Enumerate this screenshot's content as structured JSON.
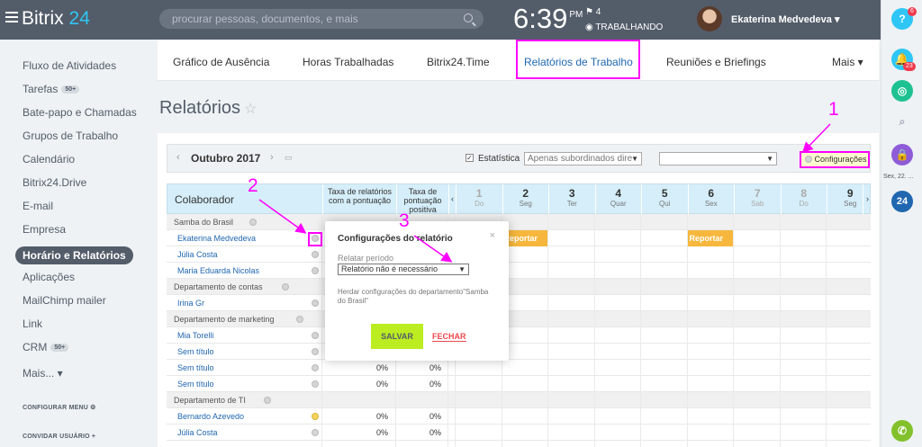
{
  "header": {
    "logo_text": "Bitrix",
    "logo_num": "24",
    "search_placeholder": "procurar pessoas, documentos, e mais",
    "time": "6:39",
    "ampm": "PM",
    "flag_count": "⚑ 4",
    "status": "◉ TRABALHANDO",
    "user_name": "Ekaterina Medvedeva ▾"
  },
  "sidebar": {
    "items": [
      {
        "label": "Fluxo de Atividades"
      },
      {
        "label": "Tarefas",
        "badge": "50+"
      },
      {
        "label": "Bate-papo e Chamadas"
      },
      {
        "label": "Grupos de Trabalho"
      },
      {
        "label": "Calendário"
      },
      {
        "label": "Bitrix24.Drive"
      },
      {
        "label": "E-mail"
      },
      {
        "label": "Empresa"
      },
      {
        "label": "Horário e Relatórios"
      },
      {
        "label": "Aplicações"
      },
      {
        "label": "MailChimp mailer"
      },
      {
        "label": "Link"
      },
      {
        "label": "CRM",
        "badge": "50+"
      },
      {
        "label": "Mais... ▾"
      }
    ],
    "configure_menu": "CONFIGURAR MENU ⚙",
    "invite_users": "CONVIDAR USUÁRIO +"
  },
  "tabs": [
    "Gráfico de Ausência",
    "Horas Trabalhadas",
    "Bitrix24.Time",
    "Relatórios de Trabalho",
    "Reuniões e Briefings",
    "Mais ▾"
  ],
  "page_title": "Relatórios",
  "filter": {
    "month": "Outubro 2017",
    "statistics_label": "Estatística",
    "subordinates_select": "Apenas subordinados dire",
    "settings_button": "Configurações"
  },
  "table": {
    "col_employee": "Colaborador",
    "col_rate1": "Taxa de relatórios com a pontuação",
    "col_rate2": "Taxa de pontuação positiva",
    "days": [
      {
        "n": "1",
        "w": "Do",
        "weekend": true
      },
      {
        "n": "2",
        "w": "Seg",
        "weekend": false
      },
      {
        "n": "3",
        "w": "Ter",
        "weekend": false
      },
      {
        "n": "4",
        "w": "Quar",
        "weekend": false
      },
      {
        "n": "5",
        "w": "Qui",
        "weekend": false
      },
      {
        "n": "6",
        "w": "Sex",
        "weekend": false
      },
      {
        "n": "7",
        "w": "Sab",
        "weekend": true
      },
      {
        "n": "8",
        "w": "Do",
        "weekend": true
      },
      {
        "n": "9",
        "w": "Seg",
        "weekend": false
      }
    ],
    "rows": [
      {
        "type": "group",
        "name": "Samba do Brasil"
      },
      {
        "type": "user",
        "name": "Ekaterina Medvedeva",
        "head": true,
        "report2": "Reportar",
        "report6": "Reportar"
      },
      {
        "type": "user",
        "name": "Júlia Costa"
      },
      {
        "type": "user",
        "name": "Maria Eduarda Nicolas"
      },
      {
        "type": "group",
        "name": "Departamento de contas"
      },
      {
        "type": "user",
        "name": "Irina Gr",
        "head": true
      },
      {
        "type": "group",
        "name": "Departamento de marketing"
      },
      {
        "type": "user",
        "name": "Mia Torelli"
      },
      {
        "type": "user",
        "name": "Sem título",
        "pct1": "0%",
        "pct2": "0%"
      },
      {
        "type": "user",
        "name": "Sem título",
        "pct1": "0%",
        "pct2": "0%"
      },
      {
        "type": "user",
        "name": "Sem título",
        "pct1": "0%",
        "pct2": "0%"
      },
      {
        "type": "group",
        "name": "Departamento de TI"
      },
      {
        "type": "user",
        "name": "Bernardo Azevedo",
        "head": true,
        "pct1": "0%",
        "pct2": "0%"
      },
      {
        "type": "user",
        "name": "Júlia Costa",
        "pct1": "0%",
        "pct2": "0%"
      }
    ]
  },
  "popup": {
    "title": "Configurações do relatório",
    "close": "×",
    "period_label": "Relatar período",
    "period_value": "Relatório não é necessário",
    "note": "Herdar configurações do departamento\"Samba do Brasil\"",
    "save": "SALVAR",
    "cancel": "FECHAR"
  },
  "rail": {
    "help": "?",
    "help_badge": "6",
    "notif_badge": "23",
    "date": "Sex, 22. ...",
    "b24": "24"
  },
  "annotations": [
    "1",
    "2",
    "3"
  ],
  "colors": {
    "annotation": "#ff00ff",
    "accent": "#2fc6f6",
    "report": "#f6b73c",
    "save": "#bbed21"
  }
}
